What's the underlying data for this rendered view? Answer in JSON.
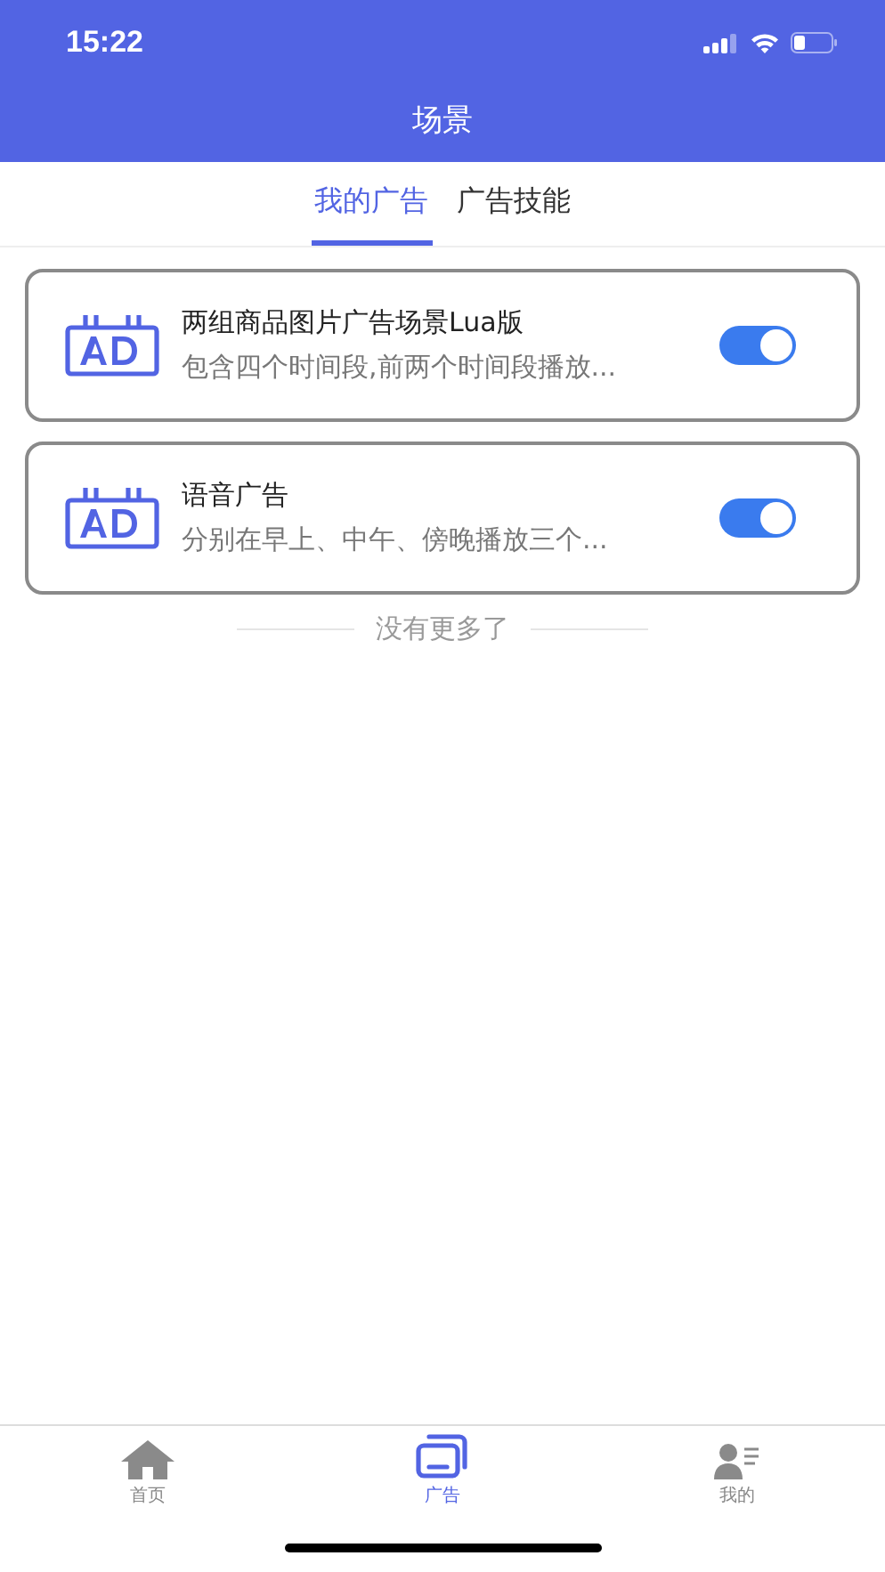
{
  "status_bar": {
    "time": "15:22"
  },
  "header": {
    "title": "场景"
  },
  "tabs": [
    {
      "label": "我的广告",
      "selected": true
    },
    {
      "label": "广告技能",
      "selected": false
    }
  ],
  "ads": [
    {
      "title": "两组商品图片广告场景Lua版",
      "description": "包含四个时间段,前两个时间段播放...",
      "on": true
    },
    {
      "title": "语音广告",
      "description": "分别在早上、中午、傍晚播放三个...",
      "on": true
    }
  ],
  "list_end": "没有更多了",
  "tab_bar": [
    {
      "kind": "home",
      "label": "首页",
      "selected": false
    },
    {
      "kind": "ads",
      "label": "广告",
      "selected": true
    },
    {
      "kind": "profile",
      "label": "我的",
      "selected": false
    }
  ]
}
